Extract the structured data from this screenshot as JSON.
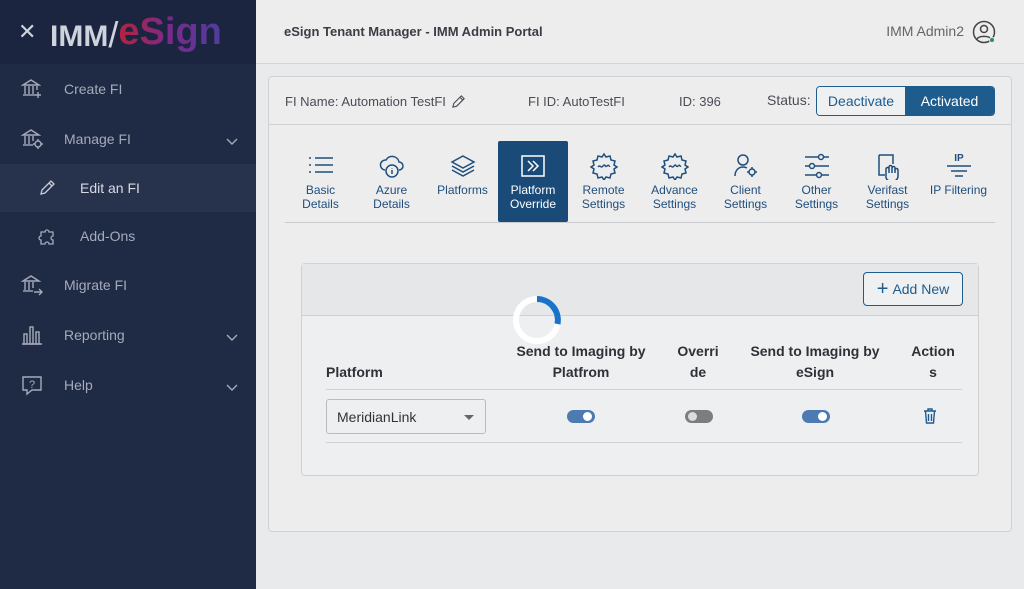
{
  "sidebar": {
    "brand_prefix": "IMM",
    "brand_sep": "/",
    "brand_name": "eSign",
    "items": [
      {
        "label": "Create FI"
      },
      {
        "label": "Manage FI"
      },
      {
        "label": "Edit an FI"
      },
      {
        "label": "Add-Ons"
      },
      {
        "label": "Migrate FI"
      },
      {
        "label": "Reporting"
      },
      {
        "label": "Help"
      }
    ]
  },
  "header": {
    "title": "eSign Tenant Manager - IMM Admin Portal",
    "user": "IMM Admin2"
  },
  "fi_info": {
    "fi_name": "FI Name: Automation TestFI",
    "fi_id": "FI ID: AutoTestFI",
    "id": "ID: 396",
    "status_label": "Status:",
    "deactivate": "Deactivate",
    "activated": "Activated"
  },
  "tabs": [
    {
      "l1": "Basic",
      "l2": "Details"
    },
    {
      "l1": "Azure",
      "l2": "Details"
    },
    {
      "l1": "Platforms",
      "l2": ""
    },
    {
      "l1": "Platform",
      "l2": "Override"
    },
    {
      "l1": "Remote",
      "l2": "Settings"
    },
    {
      "l1": "Advance",
      "l2": "Settings"
    },
    {
      "l1": "Client",
      "l2": "Settings"
    },
    {
      "l1": "Other",
      "l2": "Settings"
    },
    {
      "l1": "Verifast",
      "l2": "Settings"
    },
    {
      "l1": "IP Filtering",
      "l2": ""
    }
  ],
  "panel": {
    "add_new": "Add New",
    "columns": {
      "platform": "Platform",
      "send_platform_1": "Send to Imaging by",
      "send_platform_2": "Platfrom",
      "override_1": "Overri",
      "override_2": "de",
      "send_esign_1": "Send to Imaging by",
      "send_esign_2": "eSign",
      "actions_1": "Action",
      "actions_2": "s"
    },
    "rows": [
      {
        "platform": "MeridianLink",
        "send_by_platform": true,
        "override": false,
        "send_by_esign": true
      }
    ]
  },
  "colors": {
    "sidebar_bg": "#1f2a44",
    "accent": "#1f5c8e",
    "spinner": "#1a73c9"
  }
}
